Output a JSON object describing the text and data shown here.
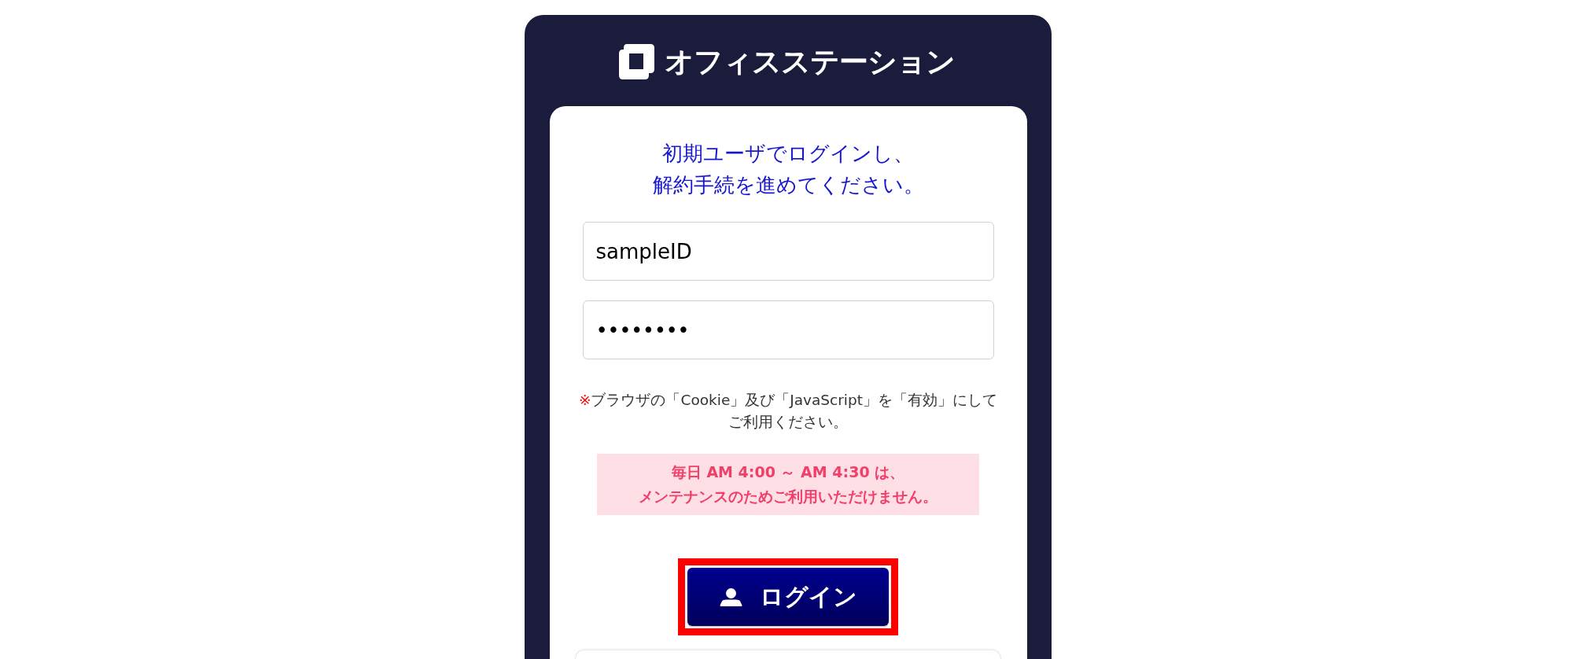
{
  "logo": {
    "text": "オフィスステーション"
  },
  "heading": [
    "初期ユーザでログインし、",
    "解約手続を進めてください。"
  ],
  "fields": [
    {
      "kind": "text",
      "value": "sampleID"
    },
    {
      "kind": "password",
      "value": "••••••••"
    }
  ],
  "note": {
    "mark": "※",
    "lines": [
      "ブラウザの「Cookie」及び「JavaScript」を「有効」にして",
      "ご利用ください。"
    ]
  },
  "notice": [
    "毎日 AM 4:00 ～ AM 4:30 は、",
    "メンテナンスのためご利用いただけません。"
  ],
  "login_button": {
    "label": "ログイン",
    "highlighted": true
  }
}
